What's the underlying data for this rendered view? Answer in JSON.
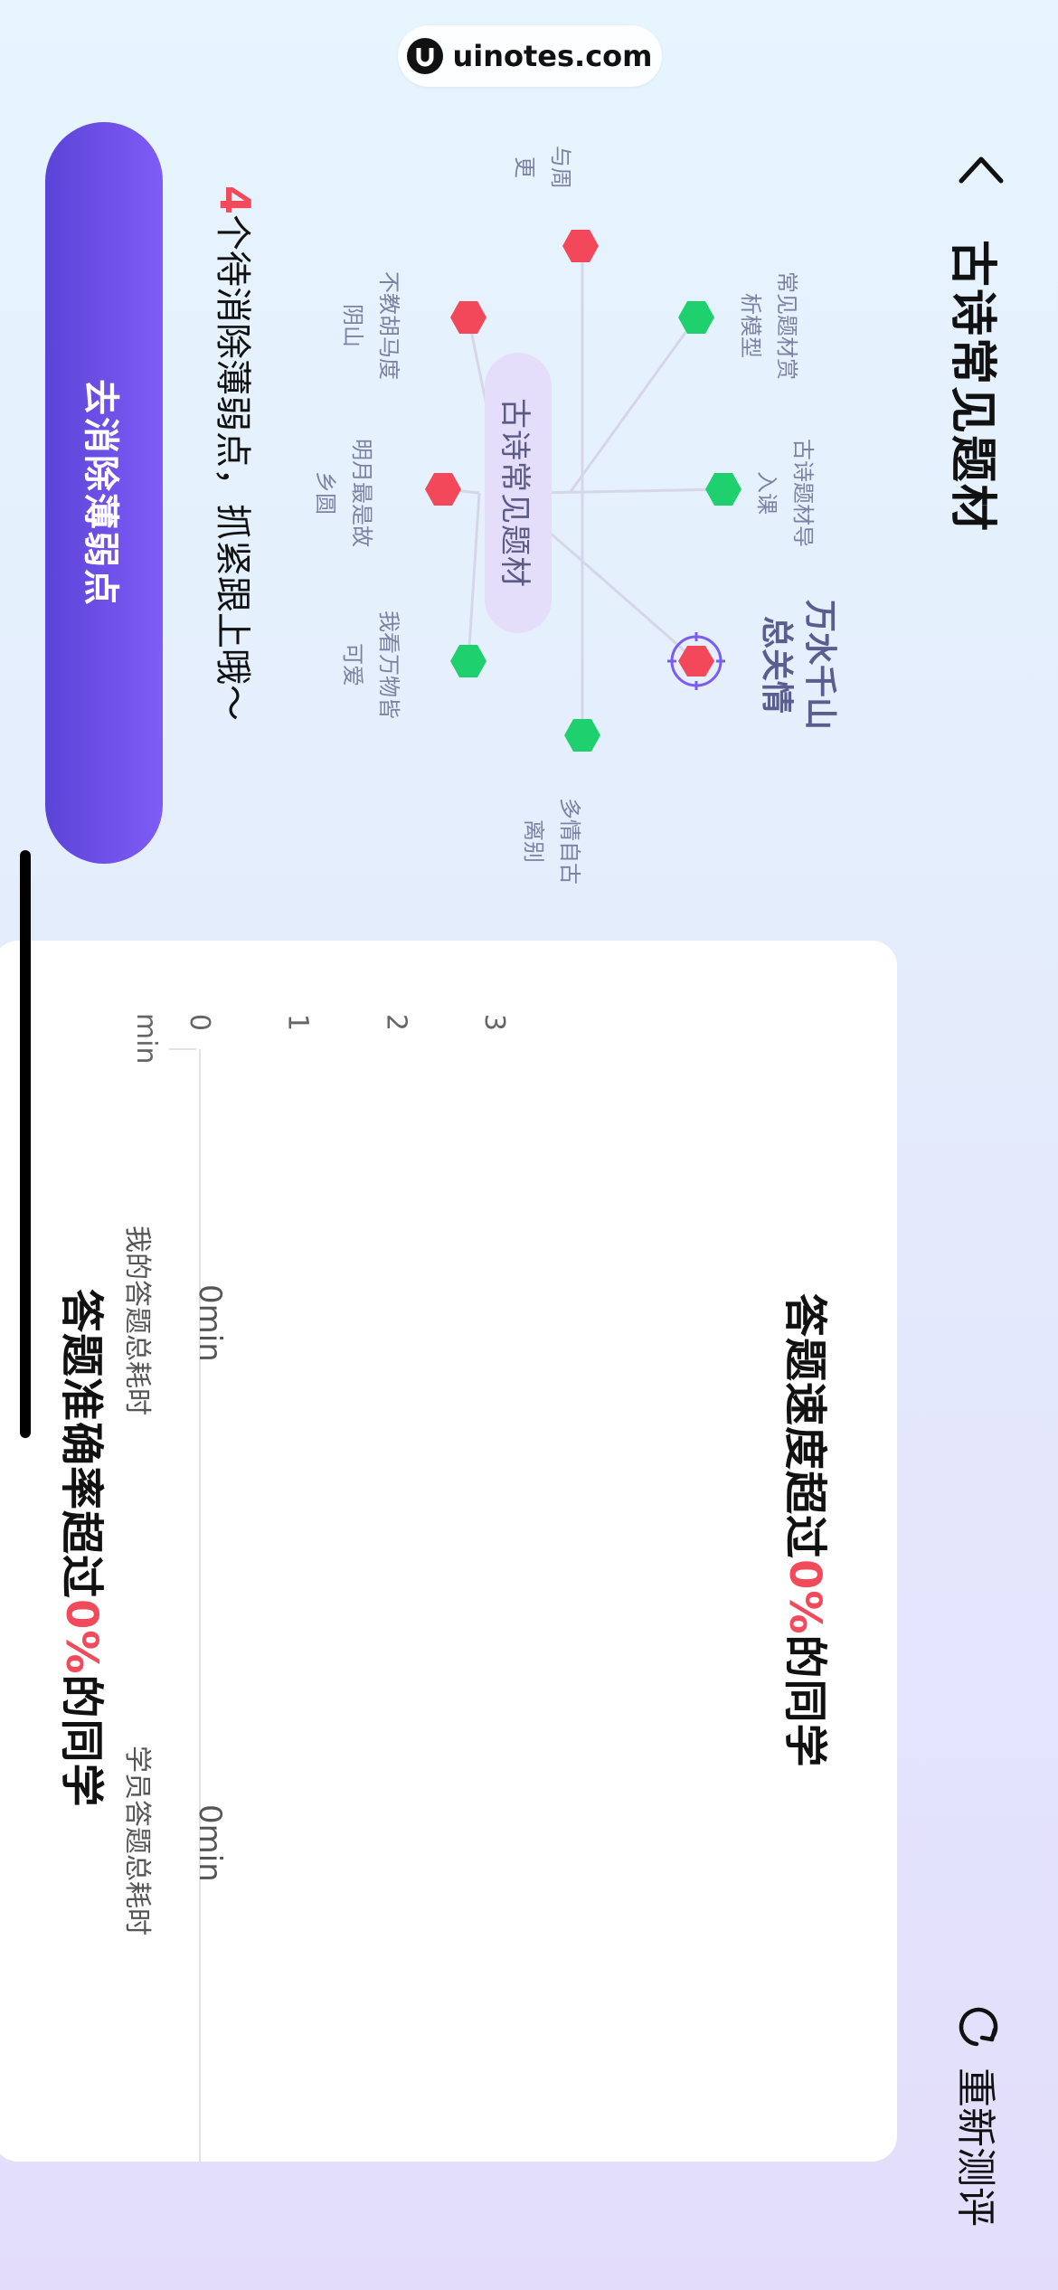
{
  "watermark": {
    "text": "uinotes.com"
  },
  "header": {
    "title": "古诗常见题材",
    "retest_label": "重新测评"
  },
  "mindmap": {
    "center": "古诗常见题材",
    "nodes": [
      {
        "lines": [
          "常见题材赏",
          "析模型"
        ],
        "status": "mastered",
        "color": "#1fd16e"
      },
      {
        "lines": [
          "古诗题材导",
          "入课"
        ],
        "status": "mastered",
        "color": "#1fd16e"
      },
      {
        "lines": [
          "万水千山",
          "总关情"
        ],
        "status": "current-weak",
        "color": "#f2485a"
      },
      {
        "lines": [
          "多情自古",
          "离别"
        ],
        "status": "mastered",
        "color": "#1fd16e"
      },
      {
        "lines": [
          "我看万物皆",
          "可爱"
        ],
        "status": "mastered",
        "color": "#1fd16e"
      },
      {
        "lines": [
          "明月最是故",
          "乡圆"
        ],
        "status": "weak",
        "color": "#f2485a"
      },
      {
        "lines": [
          "不教胡马度",
          "阴山"
        ],
        "status": "weak",
        "color": "#f2485a"
      },
      {
        "lines": [
          "与周",
          "更"
        ],
        "status": "weak",
        "color": "#f2485a"
      }
    ]
  },
  "speed_card": {
    "title_prefix": "答题速度超过",
    "title_value": "0%",
    "title_suffix": "的同学"
  },
  "chart_data": {
    "type": "bar",
    "categories": [
      "我的答题总耗时",
      "学员答题总耗时"
    ],
    "values": [
      0,
      0
    ],
    "value_labels": [
      "0min",
      "0min"
    ],
    "unit": "min",
    "yticks": [
      "0",
      "1",
      "2",
      "3"
    ],
    "ylim": [
      0,
      3
    ]
  },
  "accuracy_card": {
    "title_prefix": "答题准确率超过",
    "title_value": "0%",
    "title_suffix": "的同学"
  },
  "weak_points": {
    "count": "4",
    "text": "个待消除薄弱点，抓紧跟上哦～",
    "button_label": "去消除薄弱点"
  }
}
